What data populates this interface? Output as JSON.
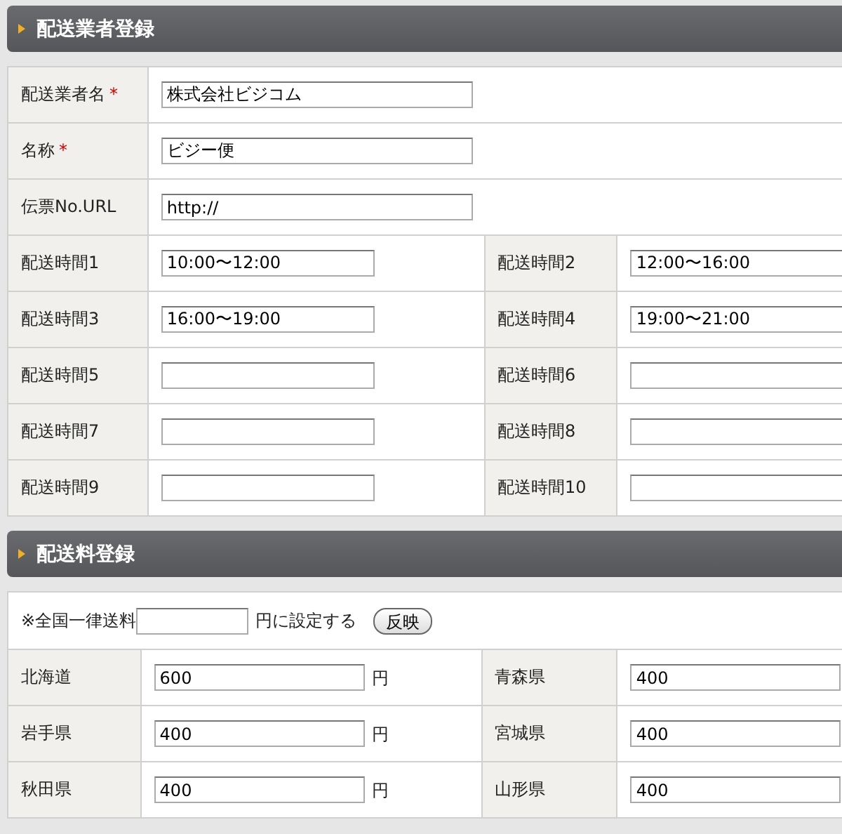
{
  "carrier_section": {
    "title": "配送業者登録",
    "fields": [
      {
        "label": "配送業者名",
        "required_mark": "*",
        "value": "株式会社ビジコム"
      },
      {
        "label": "名称",
        "required_mark": "*",
        "value": "ビジー便"
      },
      {
        "label": "伝票No.URL",
        "value": "http://"
      }
    ],
    "time_slots": [
      {
        "label": "配送時間1",
        "value": "10:00〜12:00"
      },
      {
        "label": "配送時間2",
        "value": "12:00〜16:00"
      },
      {
        "label": "配送時間3",
        "value": "16:00〜19:00"
      },
      {
        "label": "配送時間4",
        "value": "19:00〜21:00"
      },
      {
        "label": "配送時間5"
      },
      {
        "label": "配送時間6"
      },
      {
        "label": "配送時間7"
      },
      {
        "label": "配送時間8"
      },
      {
        "label": "配送時間9"
      },
      {
        "label": "配送時間10"
      }
    ]
  },
  "fee_section": {
    "title": "配送料登録",
    "flat_rate": {
      "prefix": "※全国一律送料",
      "suffix": "円に設定する",
      "button": "反映"
    },
    "prefectures": [
      {
        "name": "北海道",
        "value": "600",
        "unit": "円"
      },
      {
        "name": "青森県",
        "value": "400"
      },
      {
        "name": "岩手県",
        "value": "400",
        "unit": "円"
      },
      {
        "name": "宮城県",
        "value": "400"
      },
      {
        "name": "秋田県",
        "value": "400",
        "unit": "円"
      },
      {
        "name": "山形県",
        "value": "400"
      }
    ]
  }
}
